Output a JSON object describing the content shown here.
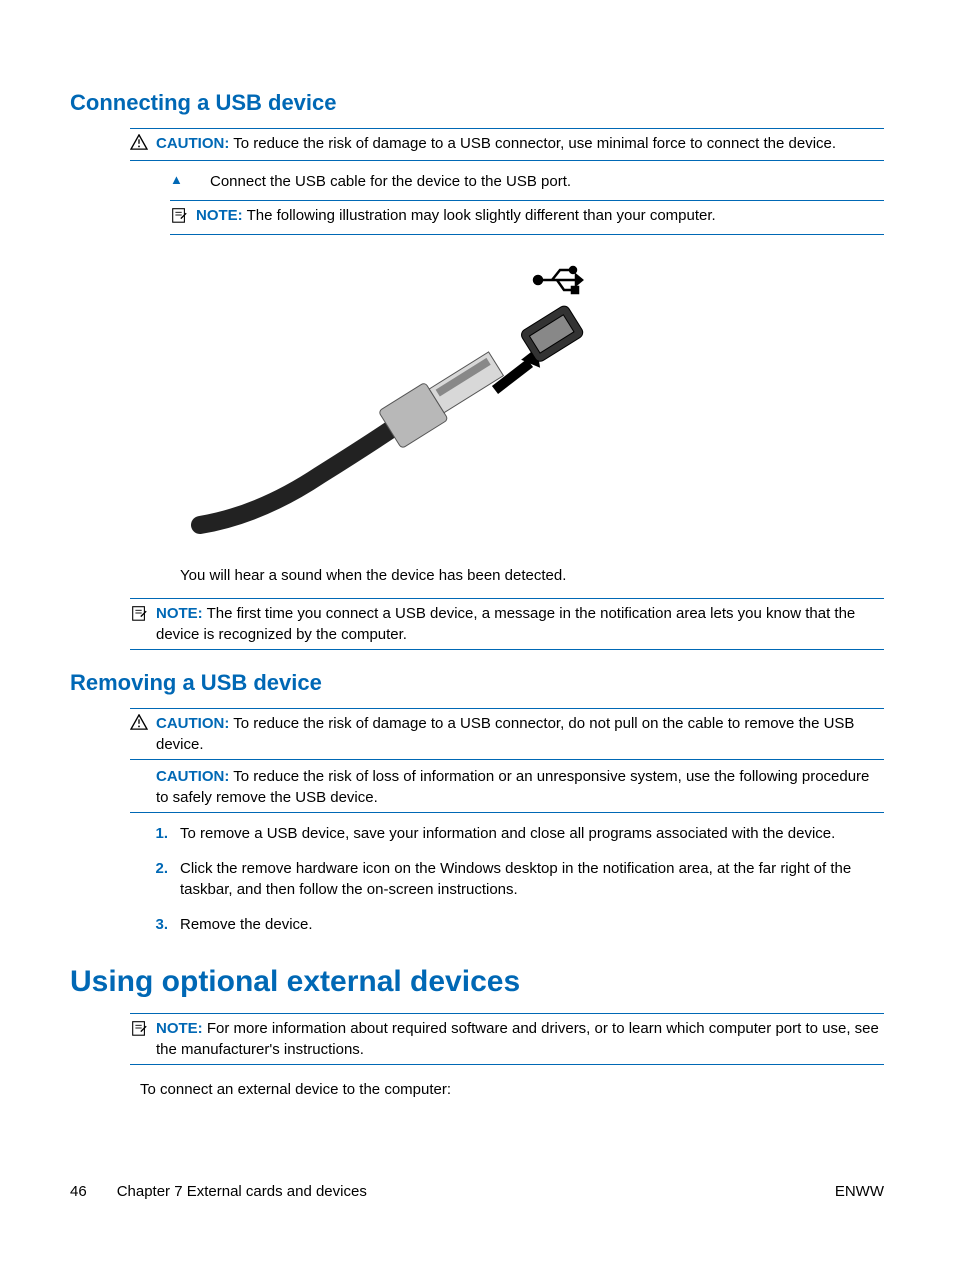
{
  "section1": {
    "heading": "Connecting a USB device",
    "caution": {
      "label": "CAUTION:",
      "text": "To reduce the risk of damage to a USB connector, use minimal force to connect the device."
    },
    "step": "Connect the USB cable for the device to the USB port.",
    "note1": {
      "label": "NOTE:",
      "text": "The following illustration may look slightly different than your computer."
    },
    "afterImage": "You will hear a sound when the device has been detected.",
    "note2": {
      "label": "NOTE:",
      "text": "The first time you connect a USB device, a message in the notification area lets you know that the device is recognized by the computer."
    }
  },
  "section2": {
    "heading": "Removing a USB device",
    "caution1": {
      "label": "CAUTION:",
      "text": "To reduce the risk of damage to a USB connector, do not pull on the cable to remove the USB device."
    },
    "caution2": {
      "label": "CAUTION:",
      "text": "To reduce the risk of loss of information or an unresponsive system, use the following procedure to safely remove the USB device."
    },
    "steps": {
      "n1": "1.",
      "t1": "To remove a USB device, save your information and close all programs associated with the device.",
      "n2": "2.",
      "t2": "Click the remove hardware icon on the Windows desktop in the notification area, at the far right of the taskbar, and then follow the on-screen instructions.",
      "n3": "3.",
      "t3": "Remove the device."
    }
  },
  "section3": {
    "heading": "Using optional external devices",
    "note": {
      "label": "NOTE:",
      "text": "For more information about required software and drivers, or to learn which computer port to use, see the manufacturer's instructions."
    },
    "paragraph": "To connect an external device to the computer:"
  },
  "footer": {
    "pageNum": "46",
    "chapter": "Chapter 7   External cards and devices",
    "right": "ENWW"
  }
}
